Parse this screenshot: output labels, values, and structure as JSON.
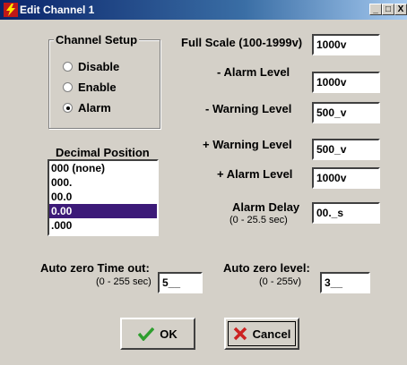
{
  "window": {
    "title": "Edit Channel 1",
    "controls": {
      "minimize": "_",
      "maximize": "□",
      "close": "X"
    }
  },
  "channel_setup": {
    "legend": "Channel Setup",
    "options": [
      {
        "label": "Disable",
        "selected": false
      },
      {
        "label": "Enable",
        "selected": false
      },
      {
        "label": "Alarm",
        "selected": true
      }
    ]
  },
  "decimal_position": {
    "label": "Decimal Position",
    "items": [
      "000 (none)",
      "000.",
      "00.0",
      "0.00",
      ".000"
    ],
    "selected_index": 3
  },
  "fields": {
    "full_scale": {
      "label": "Full Scale (100-1999v)",
      "value": "1000v"
    },
    "minus_alarm": {
      "label": "- Alarm Level",
      "value": "1000v"
    },
    "minus_warning": {
      "label": "- Warning Level",
      "value": "500_v"
    },
    "plus_warning": {
      "label": "+ Warning Level",
      "value": "500_v"
    },
    "plus_alarm": {
      "label": "+ Alarm Level",
      "value": "1000v"
    },
    "alarm_delay": {
      "label": "Alarm Delay",
      "hint": "(0 - 25.5 sec)",
      "value": "00._s"
    },
    "auto_zero_timeout": {
      "label": "Auto zero Time out:",
      "hint": "(0 - 255 sec)",
      "value": "5__"
    },
    "auto_zero_level": {
      "label": "Auto zero level:",
      "hint": "(0 - 255v)",
      "value": "3__"
    }
  },
  "buttons": {
    "ok": "OK",
    "cancel": "Cancel"
  },
  "colors": {
    "titlebar": "#0a246a",
    "selection": "#3c1a78",
    "face": "#d4d0c8",
    "ok_check": "#2e9e2e",
    "cancel_x": "#cc2222"
  },
  "icons": {
    "title": "lightning-icon",
    "ok": "checkmark-icon",
    "cancel": "x-icon"
  }
}
